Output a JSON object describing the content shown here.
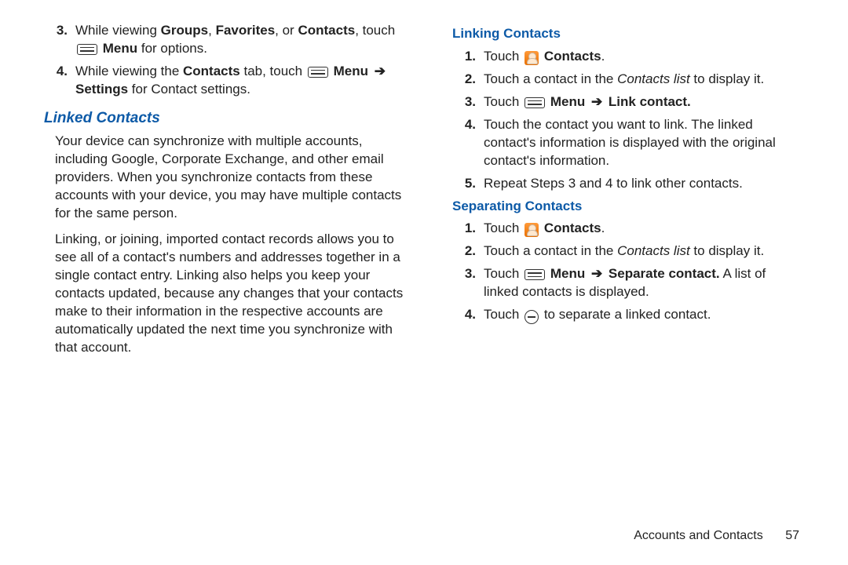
{
  "left": {
    "steps_top": [
      {
        "n": "3.",
        "pre": "While viewing ",
        "b1": "Groups",
        "mid1": ", ",
        "b2": "Favorites",
        "mid2": ", or ",
        "b3": "Contacts",
        "mid3": ", touch ",
        "b4": "Menu",
        "post": " for options."
      },
      {
        "n": "4.",
        "pre": "While viewing the ",
        "b1": "Contacts",
        "mid1": " tab, touch ",
        "b2": "Menu ",
        "b3": "Settings",
        "post": " for Contact settings."
      }
    ],
    "h_linked": "Linked Contacts",
    "p1": "Your device can synchronize with multiple accounts, including Google, Corporate Exchange, and other email providers. When you synchronize contacts from these accounts with your device, you may have multiple contacts for the same person.",
    "p2": "Linking, or joining, imported contact records allows you to see all of a contact's numbers and addresses together in a single contact entry. Linking also helps you keep your contacts updated, because any changes that your contacts make to their information in the respective accounts are automatically updated the next time you synchronize with that account."
  },
  "right": {
    "h_linking": "Linking Contacts",
    "link_steps": {
      "s1": {
        "n": "1.",
        "pre": "Touch ",
        "b1": "Contacts",
        "post": "."
      },
      "s2": {
        "n": "2.",
        "pre": "Touch a contact in the ",
        "i1": "Contacts list",
        "post": " to display it."
      },
      "s3": {
        "n": "3.",
        "pre": "Touch ",
        "b1": "Menu ",
        "b2": "Link contact."
      },
      "s4": {
        "n": "4.",
        "t": "Touch the contact you want to link. The linked contact's information is displayed with the original contact's information."
      },
      "s5": {
        "n": "5.",
        "t": "Repeat Steps 3 and 4 to link other contacts."
      }
    },
    "h_sep": "Separating Contacts",
    "sep_steps": {
      "s1": {
        "n": "1.",
        "pre": "Touch ",
        "b1": "Contacts",
        "post": "."
      },
      "s2": {
        "n": "2.",
        "pre": "Touch a contact in the ",
        "i1": "Contacts list",
        "post": " to display it."
      },
      "s3": {
        "n": "3.",
        "pre": "Touch ",
        "b1": "Menu ",
        "b2": "Separate contact.",
        "post": " A list of linked contacts is displayed."
      },
      "s4": {
        "n": "4.",
        "pre": "Touch ",
        "post": " to separate a linked contact."
      }
    }
  },
  "arrow": "➔",
  "footer": {
    "section": "Accounts and Contacts",
    "page": "57"
  }
}
